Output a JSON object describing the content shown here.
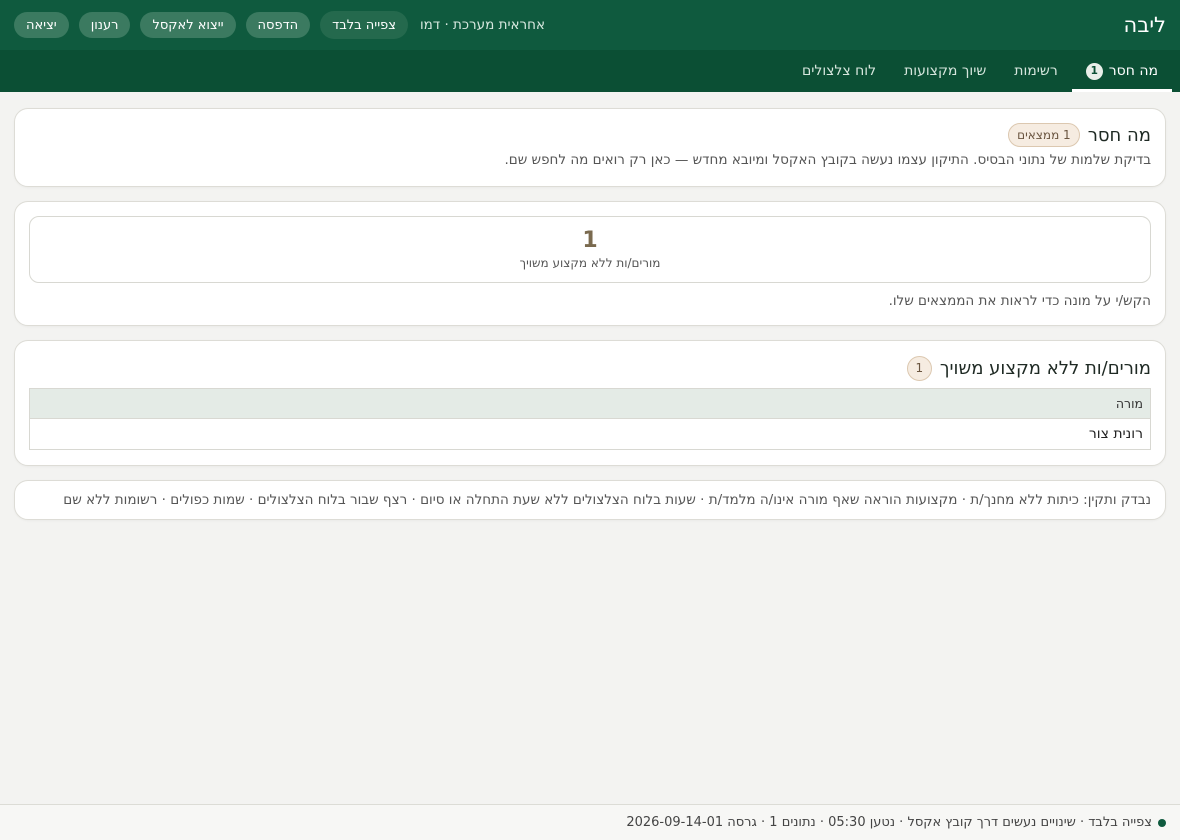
{
  "app": {
    "title": "ליבה"
  },
  "header": {
    "role_text": "אחראית מערכת · דמו",
    "buttons": {
      "view_only": "צפייה בלבד",
      "print": "הדפסה",
      "export_excel": "ייצוא לאקסל",
      "refresh": "רענון",
      "logout": "יציאה"
    }
  },
  "tabs": [
    {
      "label": "מה חסר",
      "badge": "1",
      "active": true
    },
    {
      "label": "רשימות"
    },
    {
      "label": "שיוך מקצועות"
    },
    {
      "label": "לוח צלצולים"
    }
  ],
  "summary": {
    "title": "מה חסר",
    "badge": "1 ממצאים",
    "description": "בדיקת שלמות של נתוני הבסיס. התיקון עצמו נעשה בקובץ האקסל ומיובא מחדש — כאן רק רואים מה לחפש שם."
  },
  "stat": {
    "value": "1",
    "label": "מורים/ות ללא מקצוע משויך",
    "hint": "הקש/י על מונה כדי לראות את הממצאים שלו."
  },
  "findings": {
    "title": "מורים/ות ללא מקצוע משויך",
    "count": "1",
    "columns": [
      "מורה"
    ],
    "rows": [
      [
        "רונית צור"
      ]
    ]
  },
  "checks": {
    "text": "נבדק ותקין: כיתות ללא מחנך/ת · מקצועות הוראה שאף מורה אינו/ה מלמד/ת · שעות בלוח הצלצולים ללא שעת התחלה או סיום · רצף שבור בלוח הצלצולים · שמות כפולים · רשומות ללא שם"
  },
  "footer": {
    "status_text": "צפייה בלבד · שינויים נעשים דרך קובץ אקסל · נטען 05:30 · נתונים 1 · גרסה 2026-09-14-01"
  },
  "colors": {
    "header_bg": "#0f5a3e",
    "tabbar_bg": "#0b4f34",
    "page_bg": "#f3f3f1",
    "stat_value": "#7a6a4f",
    "badge_bg": "#f6ece1"
  }
}
